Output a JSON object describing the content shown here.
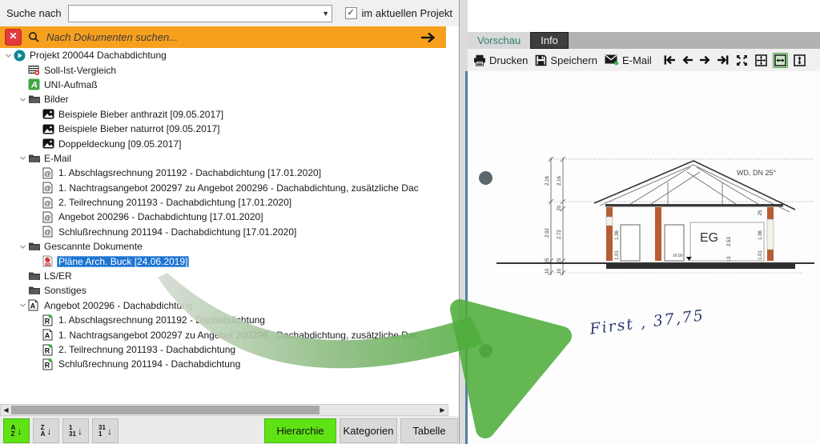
{
  "search_row": {
    "label": "Suche nach",
    "combo_value": "",
    "checkbox_checked": "✓",
    "checkbox_label": "im aktuellen Projekt"
  },
  "doc_search": {
    "close": "✕",
    "placeholder": "Nach Dokumenten suchen..."
  },
  "tree": {
    "items": [
      {
        "level": 0,
        "icon": "project",
        "expander": true,
        "label": "Projekt 200044 Dachabdichtung"
      },
      {
        "level": 1,
        "icon": "soll",
        "label": "Soll-Ist-Vergleich"
      },
      {
        "level": 1,
        "icon": "uni",
        "label": "UNI-Aufmaß"
      },
      {
        "level": 1,
        "icon": "folder",
        "expander": true,
        "label": "Bilder"
      },
      {
        "level": 2,
        "icon": "image",
        "label": "Beispiele Bieber anthrazit [09.05.2017]"
      },
      {
        "level": 2,
        "icon": "image",
        "label": "Beispiele Bieber naturrot [09.05.2017]"
      },
      {
        "level": 2,
        "icon": "image",
        "label": "Doppeldeckung [09.05.2017]"
      },
      {
        "level": 1,
        "icon": "folder",
        "expander": true,
        "label": "E-Mail"
      },
      {
        "level": 2,
        "icon": "email",
        "label": "1. Abschlagsrechnung 201192 - Dachabdichtung  [17.01.2020]"
      },
      {
        "level": 2,
        "icon": "email",
        "label": "1. Nachtragsangebot 200297 zu Angebot 200296 - Dachabdichtung, zusätzliche Dac"
      },
      {
        "level": 2,
        "icon": "email",
        "label": "2. Teilrechnung 201193 - Dachabdichtung  [17.01.2020]"
      },
      {
        "level": 2,
        "icon": "email",
        "label": "Angebot 200296 - Dachabdichtung  [17.01.2020]"
      },
      {
        "level": 2,
        "icon": "email",
        "label": "Schlußrechnung 201194 - Dachabdichtung  [17.01.2020]"
      },
      {
        "level": 1,
        "icon": "folder",
        "expander": true,
        "label": "Gescannte Dokumente"
      },
      {
        "level": 2,
        "icon": "pdf",
        "selected": true,
        "label": "Pläne Arch. Buck [24.06.2019]"
      },
      {
        "level": 1,
        "icon": "folder",
        "label": "LS/ER"
      },
      {
        "level": 1,
        "icon": "folder",
        "label": "Sonstiges"
      },
      {
        "level": 1,
        "icon": "doca",
        "expander": true,
        "label": "Angebot 200296 - Dachabdichtung"
      },
      {
        "level": 2,
        "icon": "docr",
        "label": "1. Abschlagsrechnung 201192 - Dachabdichtung"
      },
      {
        "level": 2,
        "icon": "doca",
        "label": "1. Nachtragsangebot 200297 zu Angebot 200296 - Dachabdichtung, zusätzliche Dac"
      },
      {
        "level": 2,
        "icon": "docr",
        "label": "2. Teilrechnung 201193 - Dachabdichtung"
      },
      {
        "level": 2,
        "icon": "docr",
        "label": "Schlußrechnung 201194 - Dachabdichtung"
      }
    ]
  },
  "bottom_bar": {
    "sort_buttons": [
      {
        "top": "A",
        "bottom": "Z",
        "arrow": "↓",
        "active": true
      },
      {
        "top": "Z",
        "bottom": "A",
        "arrow": "↓",
        "active": false
      },
      {
        "top": "1",
        "bottom": "31",
        "arrow": "↓",
        "active": false
      },
      {
        "top": "31",
        "bottom": "1",
        "arrow": "↓",
        "active": false
      }
    ],
    "view_buttons": [
      {
        "label": "Hierarchie",
        "active": true
      },
      {
        "label": "Kategorien",
        "active": false
      },
      {
        "label": "Tabelle",
        "active": false
      }
    ]
  },
  "right_panel": {
    "tabs": [
      {
        "label": "Vorschau",
        "active": true
      },
      {
        "label": "Info",
        "active": false
      }
    ],
    "toolbar": {
      "print": "Drucken",
      "save": "Speichern",
      "email": "E-Mail"
    },
    "preview": {
      "drawing": {
        "wd_label": "WD, DN 25°",
        "eg_label": "EG",
        "level_label": "±0.00",
        "dims": {
          "d1": "2.16",
          "d2": "2.16",
          "d3": "20",
          "d4": "2.92",
          "d5": "2.72",
          "d6": "25",
          "d7": "25",
          "d8": "10",
          "d9": "10",
          "d10": "2.53",
          "d11": "13",
          "d12": "1.36",
          "d13": "1.01",
          "d14": "1.36",
          "d15": "1.01",
          "d16": "25"
        }
      },
      "handwriting": "First , 37,75"
    }
  },
  "colors": {
    "accent_orange": "#F7A01E",
    "selection_blue": "#1D74D2",
    "active_lime": "#5FE315",
    "project_teal": "#0d8792",
    "tab_teal": "#2e7f72",
    "arrow_green": "#4fae3c",
    "pdf_red": "#d32f2f",
    "close_red": "#E23B3B",
    "wall_orange": "#b85c33",
    "page_edge_blue": "#55809f"
  }
}
